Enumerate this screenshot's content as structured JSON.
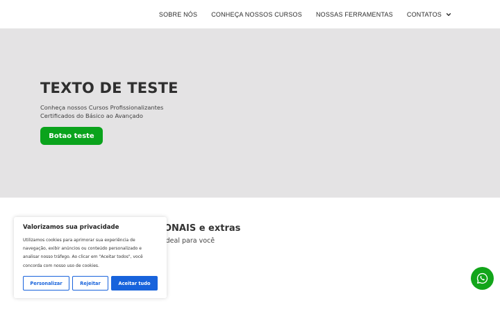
{
  "nav": {
    "items": [
      {
        "label": "SOBRE NÓS"
      },
      {
        "label": "CONHEÇA NOSSOS CURSOS"
      },
      {
        "label": "NOSSAS FERRAMENTAS"
      },
      {
        "label": "CONTATOS"
      }
    ]
  },
  "hero": {
    "title": "TEXTO DE TESTE",
    "subtitle_lines": [
      "Conheça nossos Cursos Profissionalizantes",
      "Certificados do Básico ao Avançado"
    ],
    "button_label": "Botao teste"
  },
  "section": {
    "title_visible": "ONAIS e extras",
    "subtitle_visible": "ideal para você"
  },
  "cookie": {
    "title": "Valorizamos sua privacidade",
    "text_lines": [
      "Utilizamos cookies para aprimorar sua experiência de",
      "navegação, exibir anúncios ou conteúdo personalizado e",
      "analisar nosso tráfego. Ao clicar em \"Aceitar todos\", você",
      "concorda com nosso uso de cookies."
    ],
    "buttons": {
      "customize": "Personalizar",
      "reject": "Rejeitar",
      "accept": "Aceitar tudo"
    }
  },
  "colors": {
    "hero_bg": "#e4e3e4",
    "primary_green": "#0aa31c",
    "cookie_blue": "#1863dc",
    "whatsapp_green": "#12a51a"
  },
  "icons": {
    "dropdown": "chevron-down-icon",
    "whatsapp": "whatsapp-icon"
  }
}
